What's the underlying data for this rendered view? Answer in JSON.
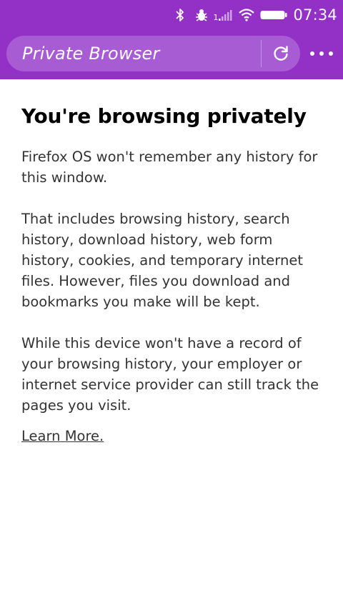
{
  "status_bar": {
    "time": "07:34",
    "sim_label": "1",
    "icons": [
      "bluetooth-icon",
      "bug-icon",
      "signal-icon",
      "wifi-icon",
      "battery-icon"
    ]
  },
  "browser": {
    "url_title": "Private Browser",
    "reload_icon": "reload-icon",
    "menu_icon": "more-options-icon"
  },
  "page": {
    "heading": "You're browsing privately",
    "paragraphs": [
      "Firefox OS won't remember any history for this window.",
      "That includes browsing history, search history, download history, web form history, cookies, and temporary internet files. However, files you download and bookmarks you make will be kept.",
      "While this device won't have a record of your browsing history, your employer or internet service provider can still track the pages you visit."
    ],
    "learn_more": "Learn More."
  },
  "colors": {
    "chrome": "#9331c7",
    "urlbar": "#a85cd3",
    "text": "#333333",
    "heading": "#000000"
  }
}
